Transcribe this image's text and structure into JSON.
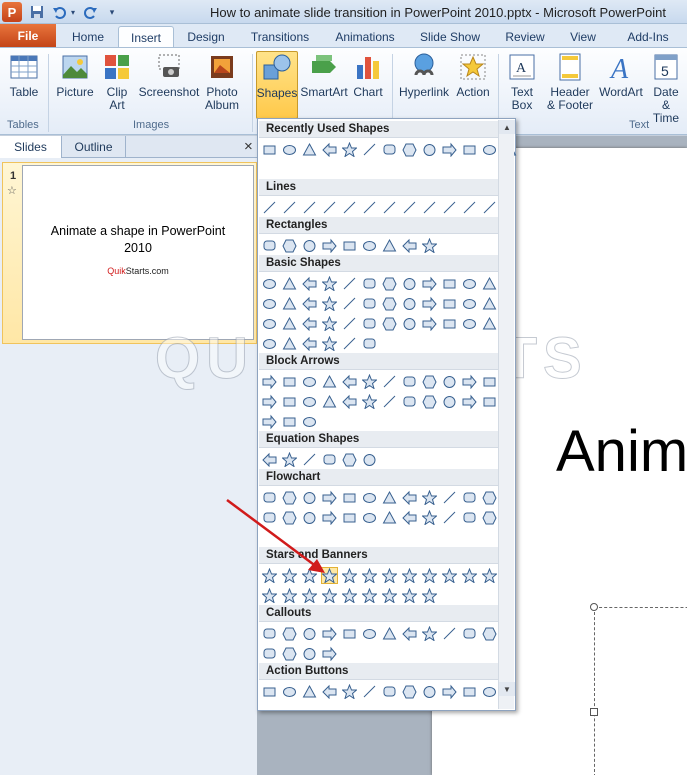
{
  "window": {
    "title": "How to animate slide transition in PowerPoint 2010.pptx - Microsoft PowerPoint",
    "app_logo": "P",
    "qat_icons": [
      "save-icon",
      "undo-icon",
      "redo-icon"
    ]
  },
  "tabs": [
    "File",
    "Home",
    "Insert",
    "Design",
    "Transitions",
    "Animations",
    "Slide Show",
    "Review",
    "View",
    "Add-Ins"
  ],
  "active_tab": "Insert",
  "ribbon": {
    "buttons": {
      "table": "Table",
      "picture": "Picture",
      "clip_art": "Clip Art",
      "screenshot": "Screenshot",
      "photo_album": "Photo Album",
      "shapes": "Shapes",
      "smartart": "SmartArt",
      "chart": "Chart",
      "hyperlink": "Hyperlink",
      "action": "Action",
      "text_box": "Text Box",
      "header_footer": "Header & Footer",
      "wordart": "WordArt",
      "date_time": "Date & Time",
      "date_icon_number": "5"
    },
    "groups": {
      "tables": "Tables",
      "images": "Images",
      "text": "Text"
    }
  },
  "pane": {
    "tab_slides": "Slides",
    "tab_outline": "Outline",
    "close_glyph": "×",
    "slide_number": "1"
  },
  "thumbnail": {
    "title": "Animate a shape in PowerPoint 2010",
    "brand_quik": "Quik",
    "brand_rest": "Starts.com"
  },
  "slide": {
    "visible_title": "Anim"
  },
  "watermark": "QUIKSTARTS",
  "shapes_menu": {
    "categories": [
      "Recently Used Shapes",
      "Lines",
      "Rectangles",
      "Basic Shapes",
      "Block Arrows",
      "Equation Shapes",
      "Flowchart",
      "Stars and Banners",
      "Callouts",
      "Action Buttons"
    ],
    "selected_shape": "5-point-star",
    "counts": {
      "recent": 13,
      "lines": 12,
      "rectangles": 9,
      "basic_rows": [
        12,
        12,
        12,
        6
      ],
      "block_rows": [
        12,
        12,
        3
      ],
      "equation": 6,
      "flowchart_rows": [
        12,
        12
      ],
      "stars_rows": [
        12,
        9
      ],
      "callouts_rows": [
        12,
        4
      ],
      "action": 12
    }
  },
  "colors": {
    "accent": "#c4421a",
    "arrow": "#d11b1b",
    "selection": "#fde8a6",
    "shape_fill": "#dbe5f1",
    "shape_stroke": "#38608f"
  }
}
